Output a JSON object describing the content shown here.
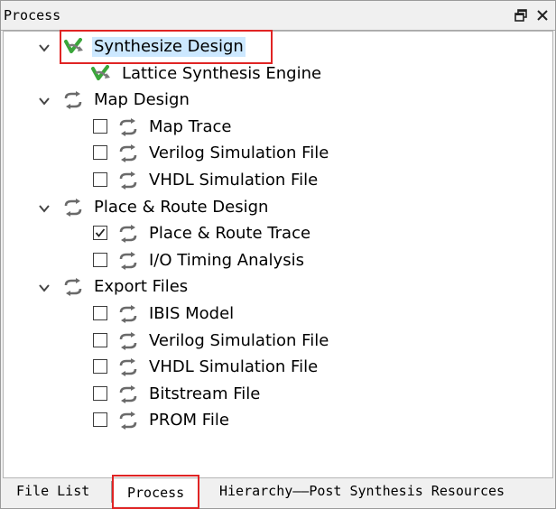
{
  "panel": {
    "title": "Process",
    "restore_icon": "restore-window-icon",
    "close_icon": "close-icon"
  },
  "tree": [
    {
      "label": "Synthesize Design",
      "level": 0,
      "expandable": true,
      "checkbox": null,
      "icon": "synthesis-check-icon",
      "selected": true
    },
    {
      "label": "Lattice Synthesis Engine",
      "level": 1,
      "expandable": false,
      "checkbox": null,
      "icon": "synthesis-check-icon",
      "selected": false
    },
    {
      "label": "Map Design",
      "level": 0,
      "expandable": true,
      "checkbox": null,
      "icon": "refresh-arrows-icon",
      "selected": false
    },
    {
      "label": "Map Trace",
      "level": 2,
      "expandable": false,
      "checkbox": false,
      "icon": "refresh-arrows-icon",
      "selected": false
    },
    {
      "label": "Verilog Simulation File",
      "level": 2,
      "expandable": false,
      "checkbox": false,
      "icon": "refresh-arrows-icon",
      "selected": false
    },
    {
      "label": "VHDL Simulation File",
      "level": 2,
      "expandable": false,
      "checkbox": false,
      "icon": "refresh-arrows-icon",
      "selected": false
    },
    {
      "label": "Place & Route Design",
      "level": 0,
      "expandable": true,
      "checkbox": null,
      "icon": "refresh-arrows-icon",
      "selected": false
    },
    {
      "label": "Place & Route Trace",
      "level": 2,
      "expandable": false,
      "checkbox": true,
      "icon": "refresh-arrows-icon",
      "selected": false
    },
    {
      "label": "I/O Timing Analysis",
      "level": 2,
      "expandable": false,
      "checkbox": false,
      "icon": "refresh-arrows-icon",
      "selected": false
    },
    {
      "label": "Export Files",
      "level": 0,
      "expandable": true,
      "checkbox": null,
      "icon": "refresh-arrows-icon",
      "selected": false
    },
    {
      "label": "IBIS Model",
      "level": 2,
      "expandable": false,
      "checkbox": false,
      "icon": "refresh-arrows-icon",
      "selected": false
    },
    {
      "label": "Verilog Simulation File",
      "level": 2,
      "expandable": false,
      "checkbox": false,
      "icon": "refresh-arrows-icon",
      "selected": false
    },
    {
      "label": "VHDL Simulation File",
      "level": 2,
      "expandable": false,
      "checkbox": false,
      "icon": "refresh-arrows-icon",
      "selected": false
    },
    {
      "label": "Bitstream File",
      "level": 2,
      "expandable": false,
      "checkbox": false,
      "icon": "refresh-arrows-icon",
      "selected": false
    },
    {
      "label": "PROM File",
      "level": 2,
      "expandable": false,
      "checkbox": false,
      "icon": "refresh-arrows-icon",
      "selected": false
    }
  ],
  "tabs": [
    {
      "label": "File List",
      "active": false
    },
    {
      "label": "Process",
      "active": true
    },
    {
      "label": "Hierarchy——Post Synthesis Resources",
      "active": false
    }
  ],
  "colors": {
    "highlight": "#e02424",
    "selection": "#cce8ff",
    "icon_green": "#3aa63a",
    "icon_gray": "#6a6a6a"
  }
}
